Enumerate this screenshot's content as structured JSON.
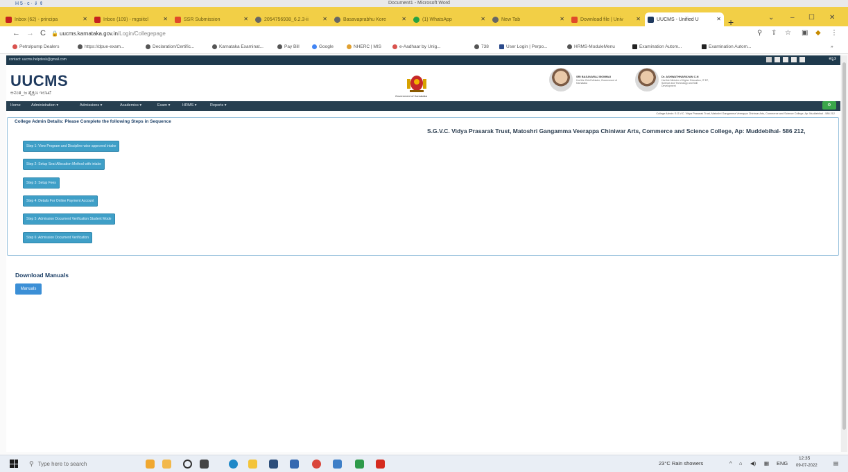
{
  "word": {
    "title": "Document1 - Microsoft Word",
    "quick_access": "H 5 · c · ⇓ ⇕"
  },
  "browser": {
    "tabs": [
      {
        "label": "Inbox (62) - principa",
        "color": "#c5221f"
      },
      {
        "label": "Inbox (109) - mgsiitcl",
        "color": "#c5221f"
      },
      {
        "label": "SSR Submission",
        "color": "#e04a2a"
      },
      {
        "label": "2054756938_6.2.3-ii",
        "color": "#666666"
      },
      {
        "label": "Basavaprabhu Kore",
        "color": "#666666"
      },
      {
        "label": "(1) WhatsApp",
        "color": "#25a244"
      },
      {
        "label": "New Tab",
        "color": "#666666"
      },
      {
        "label": "Download file | Univ",
        "color": "#e04a2a"
      },
      {
        "label": "UUCMS - Unified U",
        "color": "#1f3a5e"
      }
    ],
    "new_tab": "+",
    "url_host": "uucms.karnataka.gov.in",
    "url_path": "/Login/Collegepage",
    "bookmarks": [
      "Petrolpump Dealers",
      "https://dpue-exam...",
      "Declaration/Certific...",
      "Karnataka Examinat...",
      "Pay Bill",
      "Google",
      "NHERC | MIS",
      "e-Aadhaar by Unig...",
      "738",
      "User Login | Perpo...",
      "HRMS-ModuleMenu",
      "Examination Autom...",
      "Examination Autom..."
    ]
  },
  "page": {
    "contact": "contact: uucms.helpdesk@gmail.com",
    "lang": "ಕನ್ನಡ",
    "logo": "UUCMS",
    "logo_sub": "ಅನಂತ_ಜ ಶೈಕ್ಷಣ ಇಲಾಖೆ",
    "emblem_caption": "Government of Karnataka",
    "vip1": {
      "name": "SRI BASAVARAJ BOMMAI",
      "role": "Hon'ble Chief Minister, Government of Karnataka"
    },
    "vip2": {
      "name": "Dr. ASHWATHNARAYAN C.N",
      "role": "Hon'ble Minister of Higher Education, IT BT, Science and Technology and Skill Development"
    },
    "menu": [
      "Home",
      "Administration ▾",
      "Admissions ▾",
      "Academics ▾",
      "Exam ▾",
      "HRMS ▾",
      "Reports ▾"
    ],
    "menu_btn": "⚙",
    "ticker": "College Admin: S.G.V.C. Vidya Prasarak Trust, Matoshri Gangamma Veerappa Chiniwar Arts, Commerce and Science College, Ap: Muddebihal - 586 212",
    "admin_title": "College Admin Details: Please Complete the following Steps in Sequence",
    "college_name": "S.G.V.C. Vidya Prasarak Trust, Matoshri Gangamma Veerappa Chiniwar Arts, Commerce and Science College, Ap: Muddebihal- 586 212,",
    "steps": [
      "Step 1: View Program and Discipline wise approved intake",
      "Step 2: Setup Seat Allocation Method with intake",
      "Step 3: Setup Fees",
      "Step 4: Details For Online Payment Account",
      "Step 5: Admission Document Verification Student Mode",
      "Step 6: Admission Document Verification"
    ],
    "download_title": "Download Manuals",
    "manuals_label": "Manuals"
  },
  "taskbar": {
    "search_placeholder": "Type here to search",
    "weather": "23°C  Rain showers",
    "lang": "ENG",
    "time": "12:35",
    "date": "09-07-2022"
  },
  "colors": {
    "chrome_tabbar": "#f2cf46",
    "header_dark": "#1f3a4d",
    "step_button": "#3f9fc7",
    "manuals_button": "#3b8fd6"
  }
}
